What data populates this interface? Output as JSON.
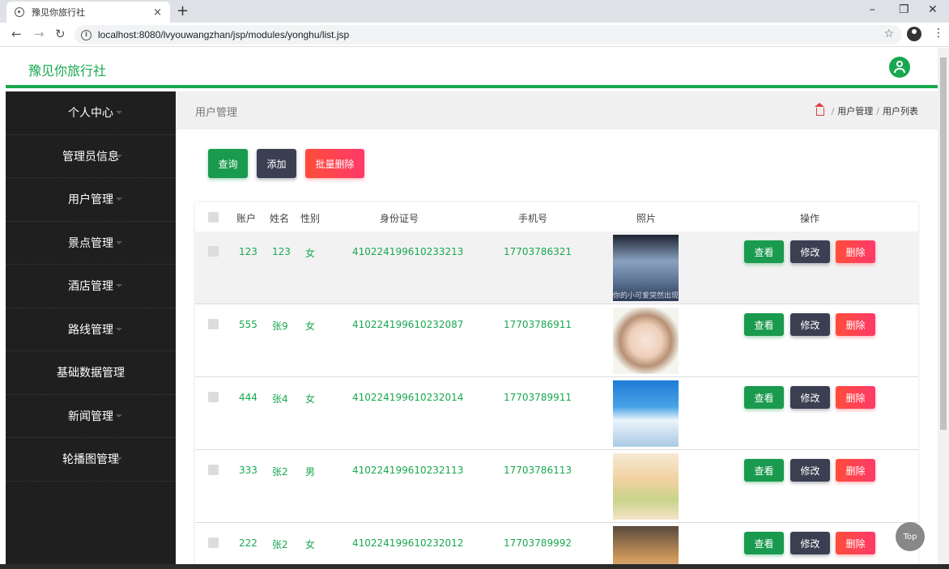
{
  "browser": {
    "tab_title": "豫见你旅行社",
    "url": "localhost:8080/lvyouwangzhan/jsp/modules/yonghu/list.jsp"
  },
  "header": {
    "brand": "豫见你旅行社",
    "accent": "#19a84f"
  },
  "sidebar": {
    "items": [
      {
        "label": "个人中心"
      },
      {
        "label": "管理员信息"
      },
      {
        "label": "用户管理"
      },
      {
        "label": "景点管理"
      },
      {
        "label": "酒店管理"
      },
      {
        "label": "路线管理"
      },
      {
        "label": "基础数据管理"
      },
      {
        "label": "新闻管理"
      },
      {
        "label": "轮播图管理"
      }
    ]
  },
  "page": {
    "title": "用户管理",
    "breadcrumb": {
      "sep": "/",
      "level1": "用户管理",
      "level2": "用户列表"
    }
  },
  "toolbar": {
    "query": "查询",
    "add": "添加",
    "batch_delete": "批量删除"
  },
  "table": {
    "headers": {
      "account": "账户",
      "name": "姓名",
      "gender": "性别",
      "id_number": "身份证号",
      "phone": "手机号",
      "photo": "照片",
      "actions": "操作"
    },
    "rows": [
      {
        "account": "123",
        "name": "123",
        "gender": "女",
        "id_number": "410224199610233213",
        "phone": "17703786321",
        "photo_caption": "你的小可爱突然出现"
      },
      {
        "account": "555",
        "name": "张9",
        "gender": "女",
        "id_number": "410224199610232087",
        "phone": "17703786911"
      },
      {
        "account": "444",
        "name": "张4",
        "gender": "女",
        "id_number": "410224199610232014",
        "phone": "17703789911"
      },
      {
        "account": "333",
        "name": "张2",
        "gender": "男",
        "id_number": "410224199610232113",
        "phone": "17703786113"
      },
      {
        "account": "222",
        "name": "张2",
        "gender": "女",
        "id_number": "410224199610232012",
        "phone": "17703789992"
      }
    ],
    "actions": {
      "view": "查看",
      "edit": "修改",
      "delete": "删除"
    }
  },
  "top_button": "Top"
}
